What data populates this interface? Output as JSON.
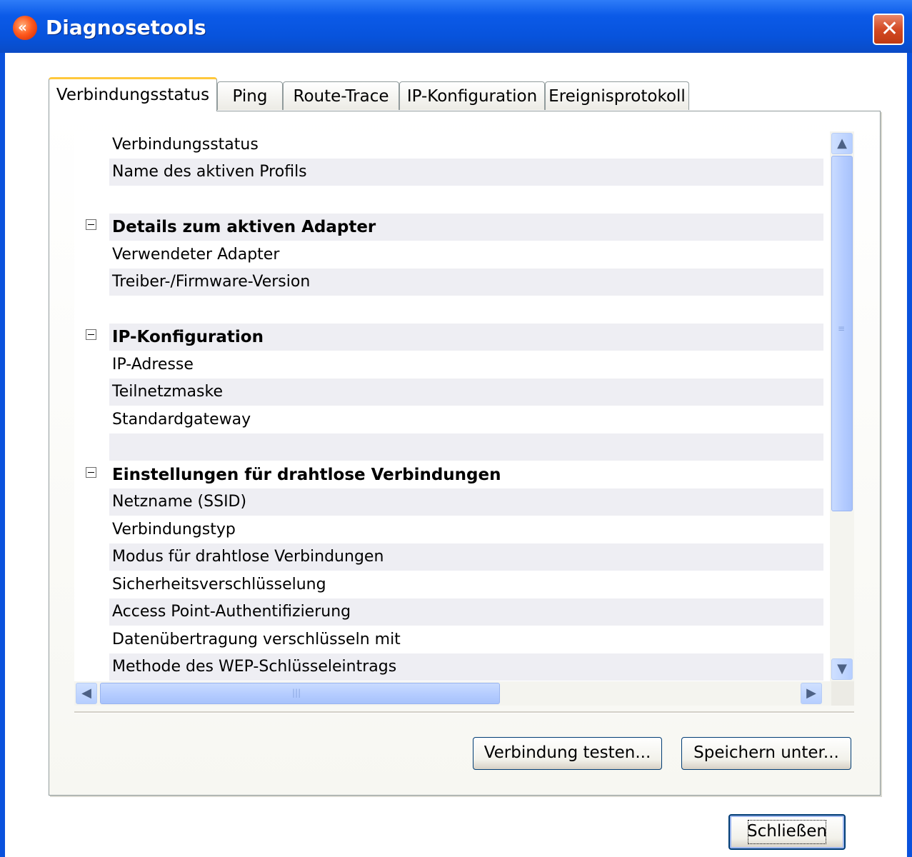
{
  "window": {
    "title": "Diagnosetools"
  },
  "tabs": [
    {
      "label": "Verbindungsstatus",
      "active": true
    },
    {
      "label": "Ping"
    },
    {
      "label": "Route-Trace"
    },
    {
      "label": "IP-Konfiguration"
    },
    {
      "label": "Ereignisprotokoll"
    }
  ],
  "rows": [
    {
      "label": "Verbindungsstatus"
    },
    {
      "label": "Name des aktiven Profils"
    },
    {
      "label": ""
    },
    {
      "label": "Details zum aktiven Adapter",
      "header": true
    },
    {
      "label": "Verwendeter Adapter"
    },
    {
      "label": "Treiber-/Firmware-Version"
    },
    {
      "label": ""
    },
    {
      "label": "IP-Konfiguration",
      "header": true
    },
    {
      "label": "IP-Adresse"
    },
    {
      "label": "Teilnetzmaske"
    },
    {
      "label": "Standardgateway"
    },
    {
      "label": ""
    },
    {
      "label": "Einstellungen für drahtlose Verbindungen",
      "header": true
    },
    {
      "label": "Netzname (SSID)"
    },
    {
      "label": "Verbindungstyp"
    },
    {
      "label": "Modus für drahtlose Verbindungen"
    },
    {
      "label": "Sicherheitsverschlüsselung"
    },
    {
      "label": "Access Point-Authentifizierung"
    },
    {
      "label": "Datenübertragung verschlüsseln mit"
    },
    {
      "label": "Methode des WEP-Schlüsseleintrags"
    }
  ],
  "buttons": {
    "test_connection": "Verbindung testen...",
    "save_as": "Speichern unter...",
    "close": "Schließen"
  },
  "colors": {
    "titlebar": "#0a52dd",
    "row_shade": "#eeeef3",
    "tab_highlight": "#ffc83c"
  }
}
